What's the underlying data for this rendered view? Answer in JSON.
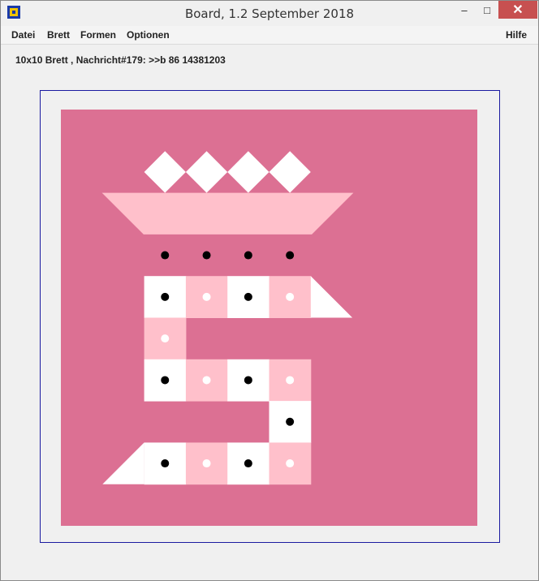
{
  "window": {
    "title": "Board, 1.2 September 2018"
  },
  "titlebar_buttons": {
    "minimize": "–",
    "maximize": "□",
    "close": "✕"
  },
  "menu": {
    "datei": "Datei",
    "brett": "Brett",
    "formen": "Formen",
    "optionen": "Optionen",
    "hilfe": "Hilfe"
  },
  "status": "10x10 Brett , Nachricht#179: >>b 86 14381203",
  "colors": {
    "board_bg": "#dc7093",
    "light_pink": "#ffc0cb",
    "white": "#ffffff",
    "black_dot": "#000000",
    "frame_border": "#1a1aa0"
  },
  "board": {
    "size": "10x10",
    "rows": [
      [
        "bg",
        "bg",
        "bg",
        "bg",
        "bg",
        "bg",
        "bg",
        "bg",
        "bg",
        "bg"
      ],
      [
        "bg",
        "bg",
        "bg",
        "bg",
        "bg",
        "bg",
        "bg",
        "bg",
        "bg",
        "bg"
      ],
      [
        "bg",
        "bg",
        "bg",
        "bg",
        "bg",
        "bg",
        "bg",
        "bg",
        "bg",
        "bg"
      ],
      [
        "bg",
        "bg",
        "bg",
        "bg",
        "bg",
        "bg",
        "bg",
        "bg",
        "bg",
        "bg"
      ],
      [
        "bg",
        "bg",
        "white-black-dot",
        "pink-white-dot",
        "white-black-dot",
        "pink-white-dot",
        "bg",
        "bg",
        "bg",
        "bg"
      ],
      [
        "bg",
        "bg",
        "pink-white-dot",
        "bg",
        "bg",
        "bg",
        "bg",
        "bg",
        "bg",
        "bg"
      ],
      [
        "bg",
        "bg",
        "white-black-dot",
        "pink-white-dot",
        "white-black-dot",
        "pink-white-dot",
        "bg",
        "bg",
        "bg",
        "bg"
      ],
      [
        "bg",
        "bg",
        "bg",
        "bg",
        "bg",
        "white-black-dot",
        "bg",
        "bg",
        "bg",
        "bg"
      ],
      [
        "bg",
        "bg",
        "white-black-dot",
        "pink-white-dot",
        "white-black-dot",
        "pink-white-dot",
        "bg",
        "bg",
        "bg",
        "bg"
      ],
      [
        "bg",
        "bg",
        "bg",
        "bg",
        "bg",
        "bg",
        "bg",
        "bg",
        "bg",
        "bg"
      ]
    ],
    "diamonds_row": 1,
    "diamonds_cols": [
      2,
      3,
      4,
      5
    ],
    "dots_only_row": 3,
    "dots_only_cols": [
      2,
      3,
      4,
      5
    ]
  }
}
